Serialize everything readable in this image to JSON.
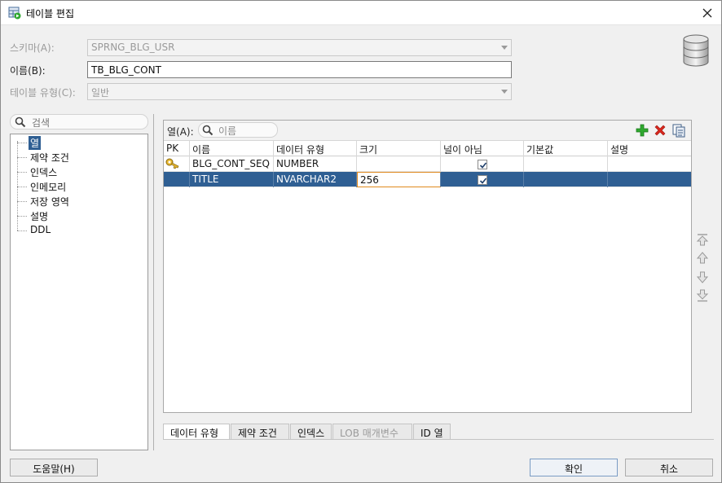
{
  "window": {
    "title": "테이블 편집"
  },
  "form": {
    "schema_label": "스키마(A):",
    "schema_value": "SPRNG_BLG_USR",
    "name_label": "이름(B):",
    "name_value": "TB_BLG_CONT",
    "table_type_label": "테이블 유형(C):",
    "table_type_value": "일반"
  },
  "sidebar": {
    "search_placeholder": "검색",
    "items": [
      {
        "label": "열",
        "selected": true
      },
      {
        "label": "제약 조건"
      },
      {
        "label": "인덱스"
      },
      {
        "label": "인메모리"
      },
      {
        "label": "저장 영역"
      },
      {
        "label": "설명"
      },
      {
        "label": "DDL"
      }
    ]
  },
  "columns_panel": {
    "label": "열(A):",
    "filter_placeholder": "이름",
    "toolbar": {
      "add_icon": "plus-icon",
      "delete_icon": "x-icon",
      "copy_icon": "copy-icon"
    },
    "headers": [
      "PK",
      "이름",
      "데이터 유형",
      "크기",
      "널이 아님",
      "기본값",
      "설명"
    ],
    "rows": [
      {
        "pk": true,
        "name": "BLG_CONT_SEQ",
        "type": "NUMBER",
        "size": "",
        "not_null": true,
        "default": "",
        "comment": ""
      },
      {
        "pk": false,
        "name": "TITLE",
        "type": "NVARCHAR2",
        "size": "256",
        "not_null": true,
        "default": "",
        "comment": ""
      }
    ]
  },
  "bottom_tabs": [
    "데이터 유형",
    "제약 조건",
    "인덱스",
    "LOB 매개변수",
    "ID 열"
  ],
  "buttons": {
    "help": "도움말(H)",
    "ok": "확인",
    "cancel": "취소"
  },
  "colors": {
    "selection": "#2f5f93",
    "add": "#2ea82e",
    "delete": "#d9261c"
  }
}
